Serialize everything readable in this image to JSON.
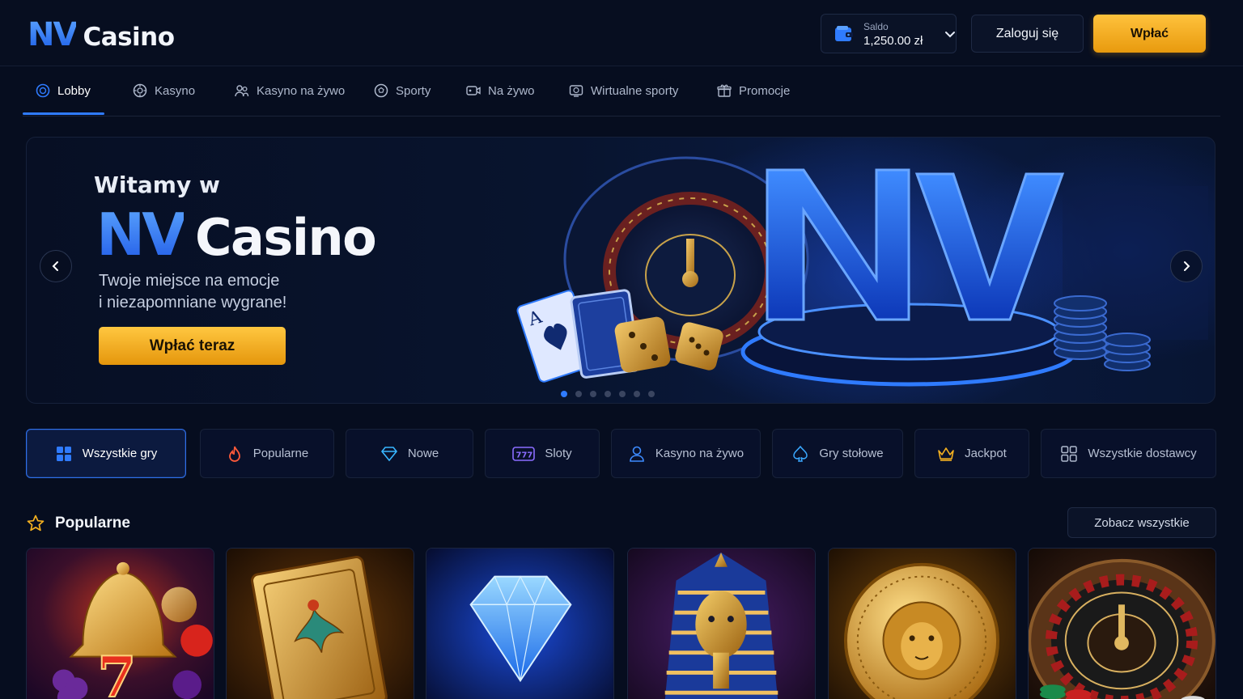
{
  "header": {
    "logo_nv": "NV",
    "logo_casino": "Casino",
    "balance_label": "Saldo",
    "balance_value": "1,250.00 zł",
    "login_label": "Zaloguj się",
    "deposit_label": "Wpłać"
  },
  "nav": {
    "items": [
      {
        "label": "Lobby",
        "icon": "lobby-icon",
        "active": true
      },
      {
        "label": "Kasyno",
        "icon": "casino-chip-icon"
      },
      {
        "label": "Kasyno na żywo",
        "icon": "live-dealer-icon"
      },
      {
        "label": "Sporty",
        "icon": "soccer-ball-icon"
      },
      {
        "label": "Na żywo",
        "icon": "live-video-icon"
      },
      {
        "label": "Wirtualne sporty",
        "icon": "virtual-sports-icon"
      },
      {
        "label": "Promocje",
        "icon": "gift-icon"
      }
    ]
  },
  "hero": {
    "welcome": "Witamy w",
    "brand_nv": "NV",
    "brand_casino": "Casino",
    "tagline_line1": "Twoje miejsce na emocje",
    "tagline_line2": "i niezapomniane wygrane!",
    "cta_label": "Wpłać teraz",
    "art_letters": "NV",
    "slide_count": 7,
    "active_slide": 1
  },
  "categories": [
    {
      "label": "Wszystkie gry",
      "icon": "grid-icon",
      "active": true
    },
    {
      "label": "Popularne",
      "icon": "flame-icon"
    },
    {
      "label": "Nowe",
      "icon": "diamond-icon"
    },
    {
      "label": "Sloty",
      "icon": "slot-777-icon"
    },
    {
      "label": "Kasyno na żywo",
      "icon": "user-icon"
    },
    {
      "label": "Gry stołowe",
      "icon": "spade-icon"
    },
    {
      "label": "Jackpot",
      "icon": "crown-icon"
    },
    {
      "label": "Wszystkie dostawcy",
      "icon": "providers-grid-icon"
    }
  ],
  "popular": {
    "title": "Popularne",
    "see_all_label": "Zobacz wszystkie",
    "tiles": [
      {
        "name": "bell-fruits-slot",
        "art": "golden bell, lucky seven, fruits"
      },
      {
        "name": "book-slot",
        "art": "golden egyptian book"
      },
      {
        "name": "diamond-slot",
        "art": "blue diamond"
      },
      {
        "name": "pharaoh-slot",
        "art": "pharaoh mask"
      },
      {
        "name": "lion-coin-slot",
        "art": "golden lion coin"
      },
      {
        "name": "roulette-table",
        "art": "roulette wheel with chips"
      }
    ]
  },
  "colors": {
    "background": "#060d1f",
    "accent_blue": "#2f7bff",
    "accent_gold": "#f5b120"
  }
}
